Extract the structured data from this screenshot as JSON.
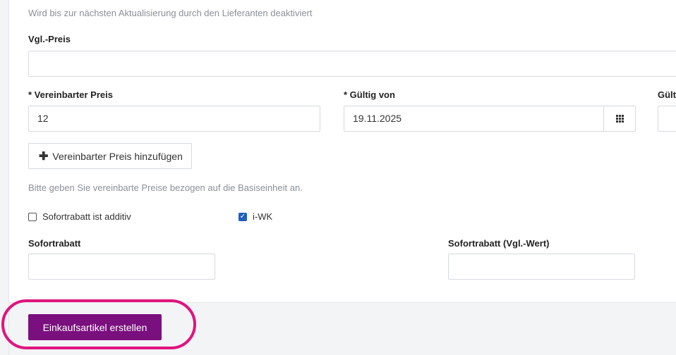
{
  "supplier_hint": "Wird bis zur nächsten Aktualisierung durch den Lieferanten deaktiviert",
  "fields": {
    "vgl_preis": {
      "label": "Vgl.-Preis",
      "value": ""
    },
    "vereinbarter_preis": {
      "label": "* Vereinbarter Preis",
      "value": "12"
    },
    "gueltig_von": {
      "label": "* Gültig von",
      "value": "19.11.2025",
      "icon": "calendar-grid-icon"
    },
    "gueltig_bis": {
      "label": "Gült",
      "value": ""
    },
    "sofortrabatt": {
      "label": "Sofortrabatt",
      "value": ""
    },
    "sofortrabatt_vgl": {
      "label": "Sofortrabatt (Vgl.-Wert)",
      "value": ""
    }
  },
  "add_price_button": {
    "icon": "plus-icon",
    "label": "Vereinbarter Preis hinzufügen"
  },
  "price_hint": "Bitte geben Sie vereinbarte Preise bezogen auf die Basiseinheit an.",
  "checkboxes": {
    "additiv": {
      "label": "Sofortrabatt ist additiv",
      "checked": false
    },
    "iwk": {
      "label": "i-WK",
      "checked": true
    }
  },
  "footer": {
    "create_label": "Einkaufsartikel erstellen"
  },
  "colors": {
    "primary": "#7a0f7e",
    "highlight": "#e0147e",
    "checkbox": "#1f5fbf"
  }
}
